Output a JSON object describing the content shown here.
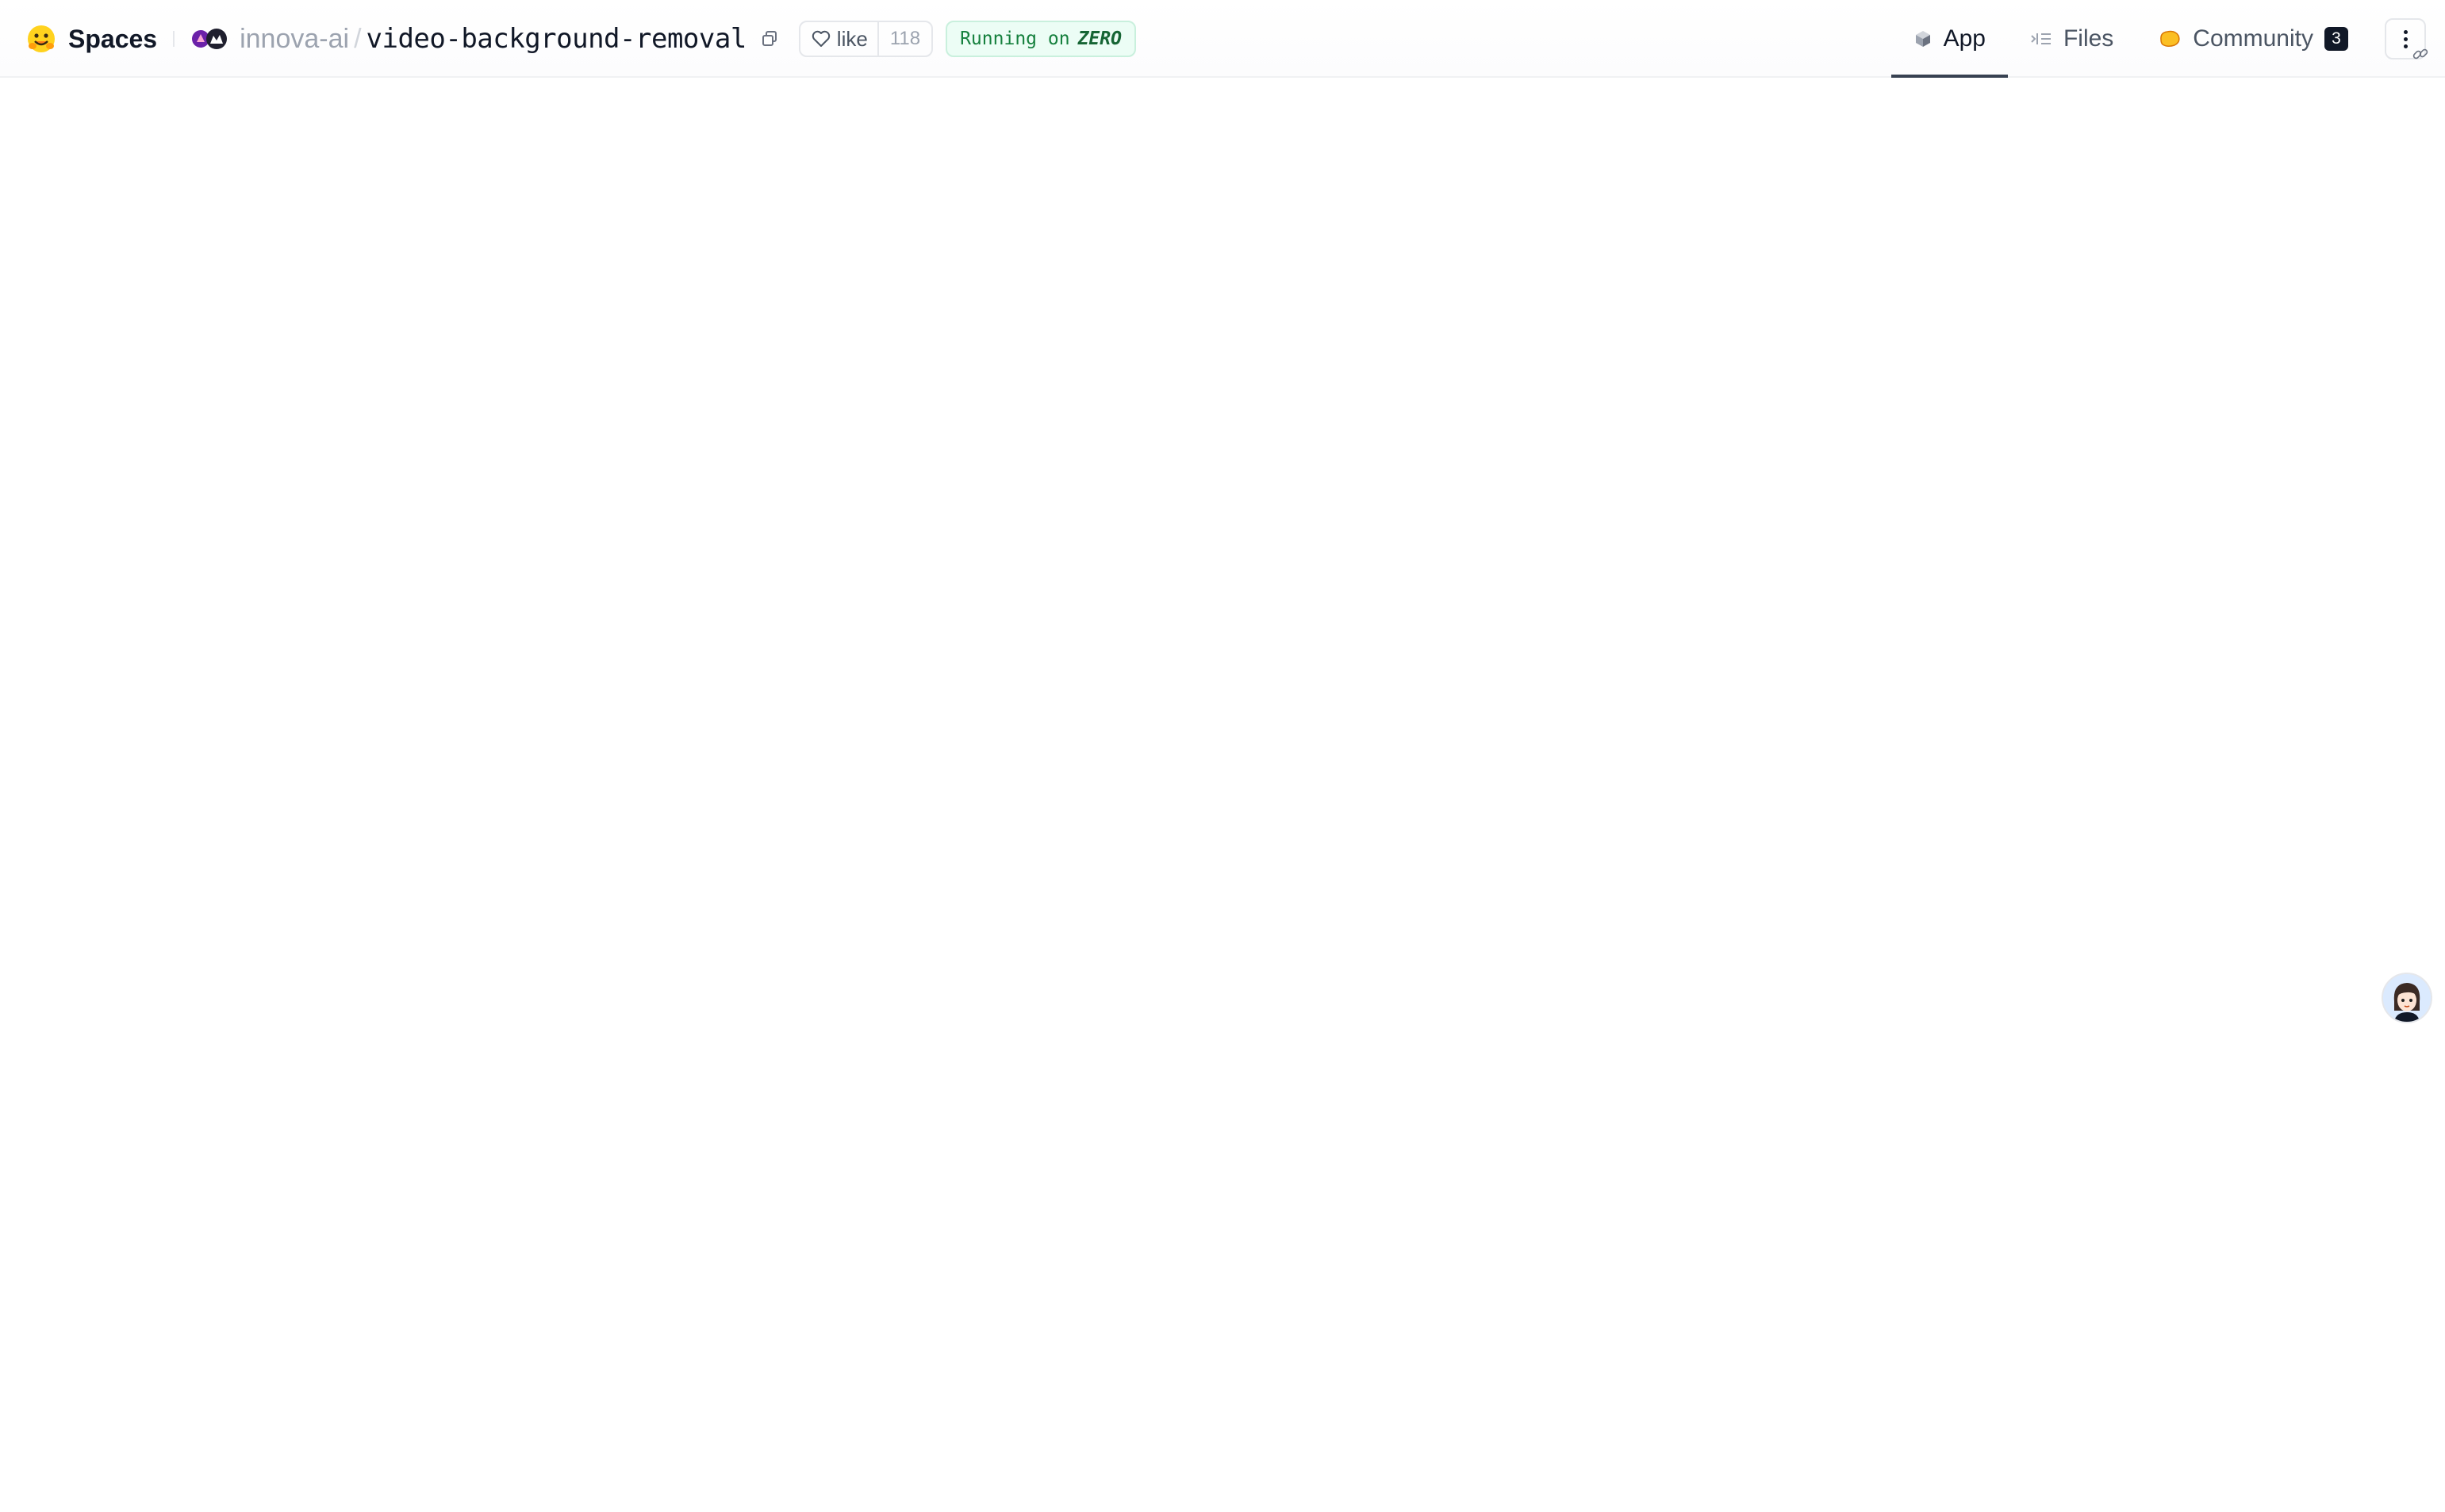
{
  "header": {
    "brand_label": "Spaces",
    "owner": "innova-ai",
    "separator": "/",
    "repo_name": "video-background-removal",
    "like_label": "like",
    "like_count": "118",
    "status_prefix": "Running on",
    "status_hardware": "ZERO"
  },
  "tabs": [
    {
      "label": "App",
      "icon": "cube-icon",
      "active": true
    },
    {
      "label": "Files",
      "icon": "files-icon",
      "active": false
    },
    {
      "label": "Community",
      "icon": "community-icon",
      "active": false,
      "badge": "3"
    }
  ],
  "colors": {
    "status_text": "#15803d",
    "status_bg": "#ecfdf5",
    "active_tab_underline": "#374151",
    "badge_bg": "#111827"
  }
}
